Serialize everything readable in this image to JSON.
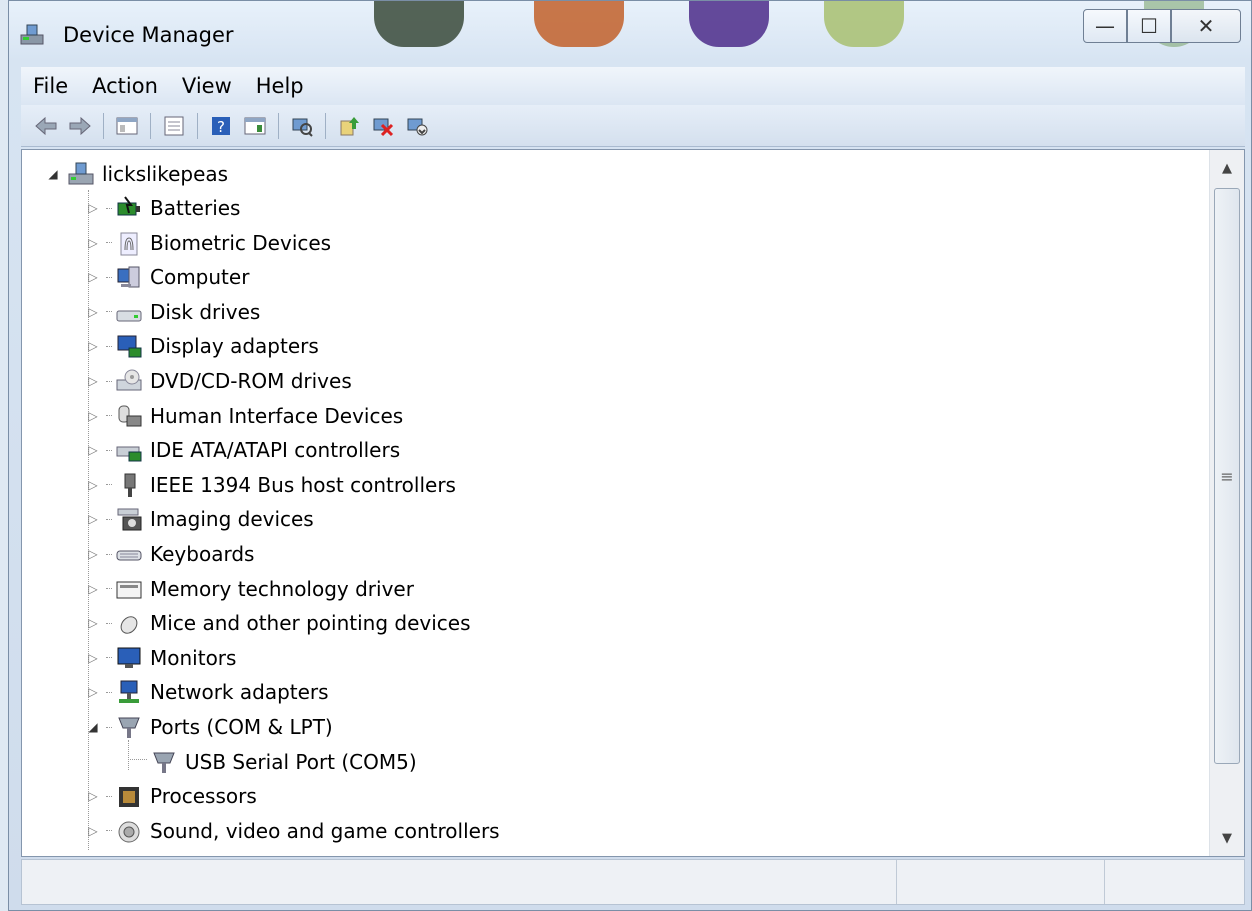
{
  "window": {
    "title": "Device Manager"
  },
  "menu": [
    "File",
    "Action",
    "View",
    "Help"
  ],
  "toolbar_icons": [
    "back-arrow-icon",
    "forward-arrow-icon",
    "show-hide-console-tree-icon",
    "properties-icon",
    "help-icon",
    "show-action-pane-icon",
    "scan-hardware-icon",
    "update-driver-icon",
    "uninstall-icon",
    "disable-icon"
  ],
  "tree": {
    "root": "lickslikepeas",
    "categories": [
      {
        "label": "Batteries",
        "icon": "battery-icon",
        "expanded": false
      },
      {
        "label": "Biometric Devices",
        "icon": "fingerprint-icon",
        "expanded": false
      },
      {
        "label": "Computer",
        "icon": "computer-icon",
        "expanded": false
      },
      {
        "label": "Disk drives",
        "icon": "disk-drive-icon",
        "expanded": false
      },
      {
        "label": "Display adapters",
        "icon": "display-adapter-icon",
        "expanded": false
      },
      {
        "label": "DVD/CD-ROM drives",
        "icon": "dvd-drive-icon",
        "expanded": false
      },
      {
        "label": "Human Interface Devices",
        "icon": "hid-icon",
        "expanded": false
      },
      {
        "label": "IDE ATA/ATAPI controllers",
        "icon": "ide-controller-icon",
        "expanded": false
      },
      {
        "label": "IEEE 1394 Bus host controllers",
        "icon": "firewire-icon",
        "expanded": false
      },
      {
        "label": "Imaging devices",
        "icon": "camera-icon",
        "expanded": false
      },
      {
        "label": "Keyboards",
        "icon": "keyboard-icon",
        "expanded": false
      },
      {
        "label": "Memory technology driver",
        "icon": "memory-icon",
        "expanded": false
      },
      {
        "label": "Mice and other pointing devices",
        "icon": "mouse-icon",
        "expanded": false
      },
      {
        "label": "Monitors",
        "icon": "monitor-icon",
        "expanded": false
      },
      {
        "label": "Network adapters",
        "icon": "network-icon",
        "expanded": false
      },
      {
        "label": "Ports (COM & LPT)",
        "icon": "port-icon",
        "expanded": true,
        "children": [
          "USB Serial Port (COM5)"
        ]
      },
      {
        "label": "Processors",
        "icon": "processor-icon",
        "expanded": false
      },
      {
        "label": "Sound, video and game controllers",
        "icon": "speaker-icon",
        "expanded": false
      }
    ]
  },
  "colors": {
    "chrome": "#d7e4f2",
    "accent": "#2a6fc9"
  }
}
